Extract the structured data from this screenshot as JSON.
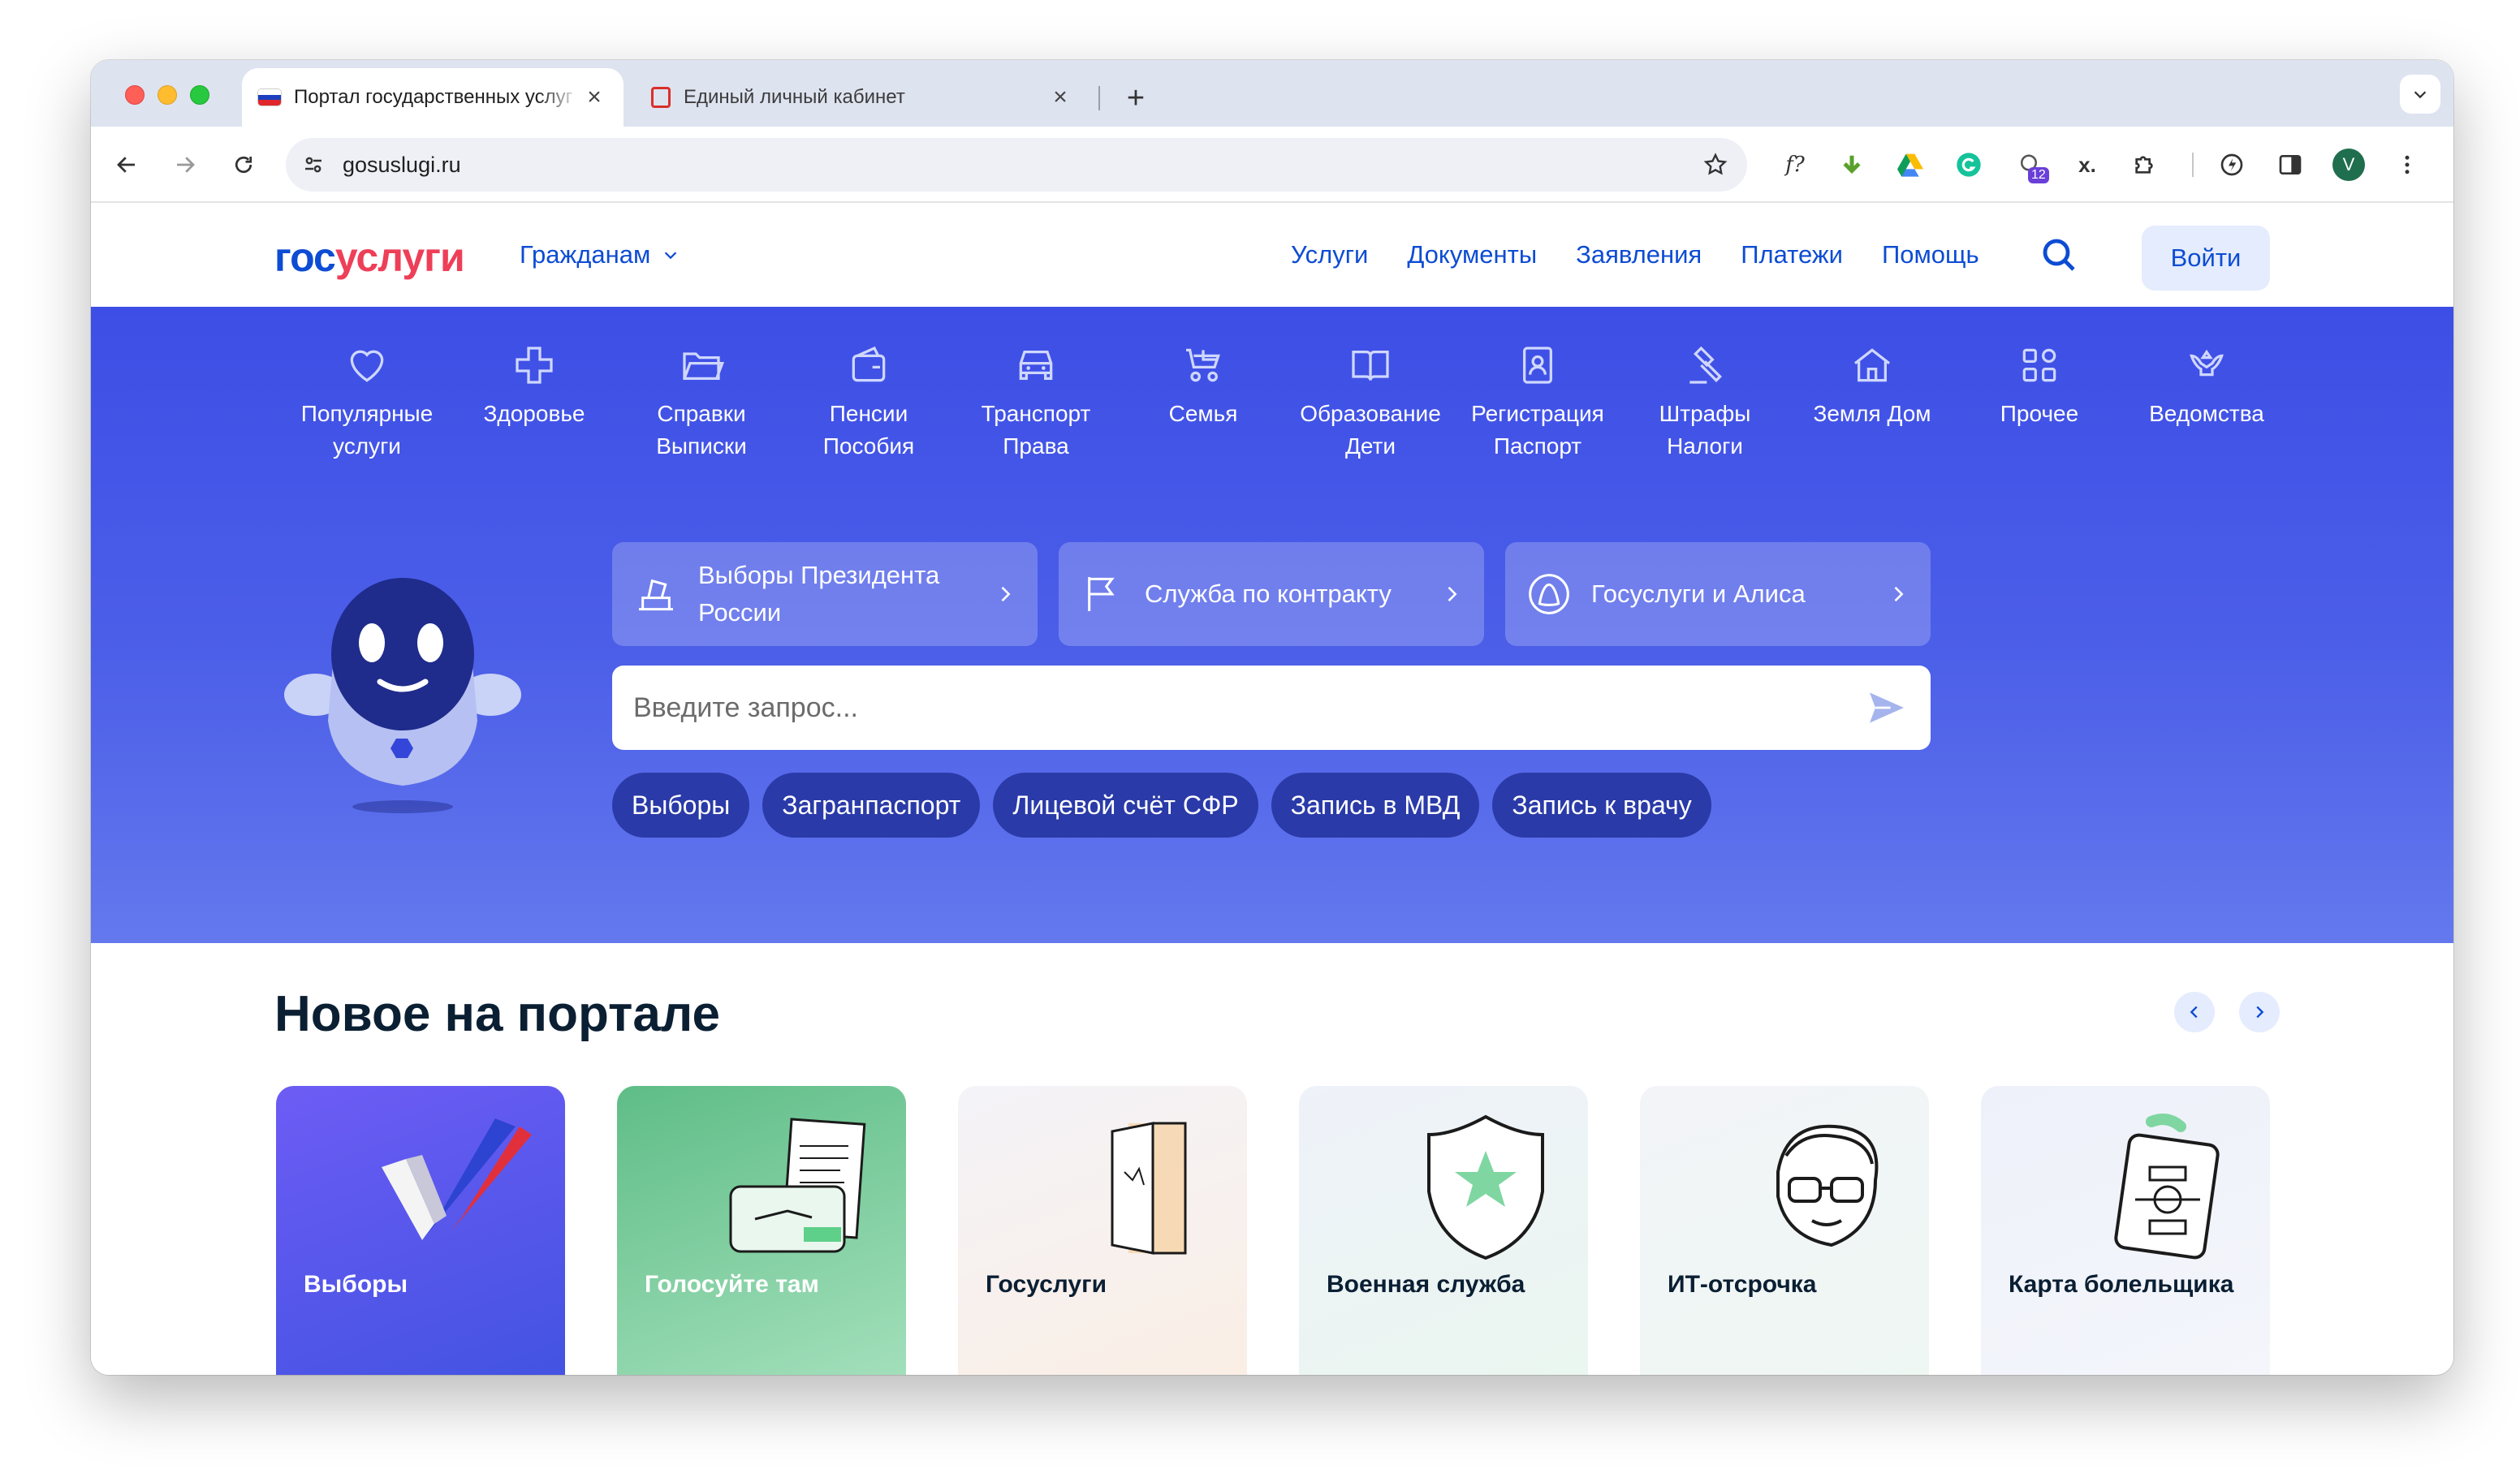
{
  "browser": {
    "tabs": [
      {
        "title": "Портал государственных услуг",
        "active": true
      },
      {
        "title": "Единый личный кабинет",
        "active": false
      }
    ],
    "new_tab_label": "+",
    "close_glyph": "×",
    "url": "gosuslugi.ru",
    "extension_badge": "12",
    "profile_initial": "V",
    "extension_formula": "f?",
    "extension_x": "x."
  },
  "site": {
    "logo_part1": "гос",
    "logo_part2": "услуги",
    "audience": "Гражданам",
    "nav": [
      "Услуги",
      "Документы",
      "Заявления",
      "Платежи",
      "Помощь"
    ],
    "login": "Войти",
    "categories": [
      {
        "label": "Популярные услуги",
        "icon": "heart-icon"
      },
      {
        "label": "Здоровье",
        "icon": "cross-icon"
      },
      {
        "label": "Справки Выписки",
        "icon": "folder-icon"
      },
      {
        "label": "Пенсии Пособия",
        "icon": "wallet-icon"
      },
      {
        "label": "Транспорт Права",
        "icon": "car-icon"
      },
      {
        "label": "Семья",
        "icon": "stroller-icon"
      },
      {
        "label": "Образование Дети",
        "icon": "book-icon"
      },
      {
        "label": "Регистрация Паспорт",
        "icon": "passport-icon"
      },
      {
        "label": "Штрафы Налоги",
        "icon": "gavel-icon"
      },
      {
        "label": "Земля Дом",
        "icon": "house-icon"
      },
      {
        "label": "Прочее",
        "icon": "grid-icon"
      },
      {
        "label": "Ведомства",
        "icon": "emblem-icon"
      }
    ],
    "promos": [
      {
        "label": "Выборы Президента России",
        "icon": "ballot-icon"
      },
      {
        "label": "Служба по контракту",
        "icon": "flag-icon"
      },
      {
        "label": "Госуслуги и Алиса",
        "icon": "alice-icon"
      }
    ],
    "search_placeholder": "Введите запрос...",
    "chips": [
      "Выборы",
      "Загранпаспорт",
      "Лицевой счёт СФР",
      "Запись в МВД",
      "Запись к врачу"
    ],
    "news_title": "Новое на портале",
    "cards": [
      {
        "title": "Выборы"
      },
      {
        "title": "Голосуйте там"
      },
      {
        "title": "Госуслуги"
      },
      {
        "title": "Военная служба"
      },
      {
        "title": "ИТ-отсрочка"
      },
      {
        "title": "Карта болельщика"
      }
    ]
  },
  "colors": {
    "brand_blue": "#0d4cd3",
    "brand_red": "#ee3f58",
    "hero_blue": "#3d4ee6",
    "chip_blue": "#2a3aa8"
  }
}
